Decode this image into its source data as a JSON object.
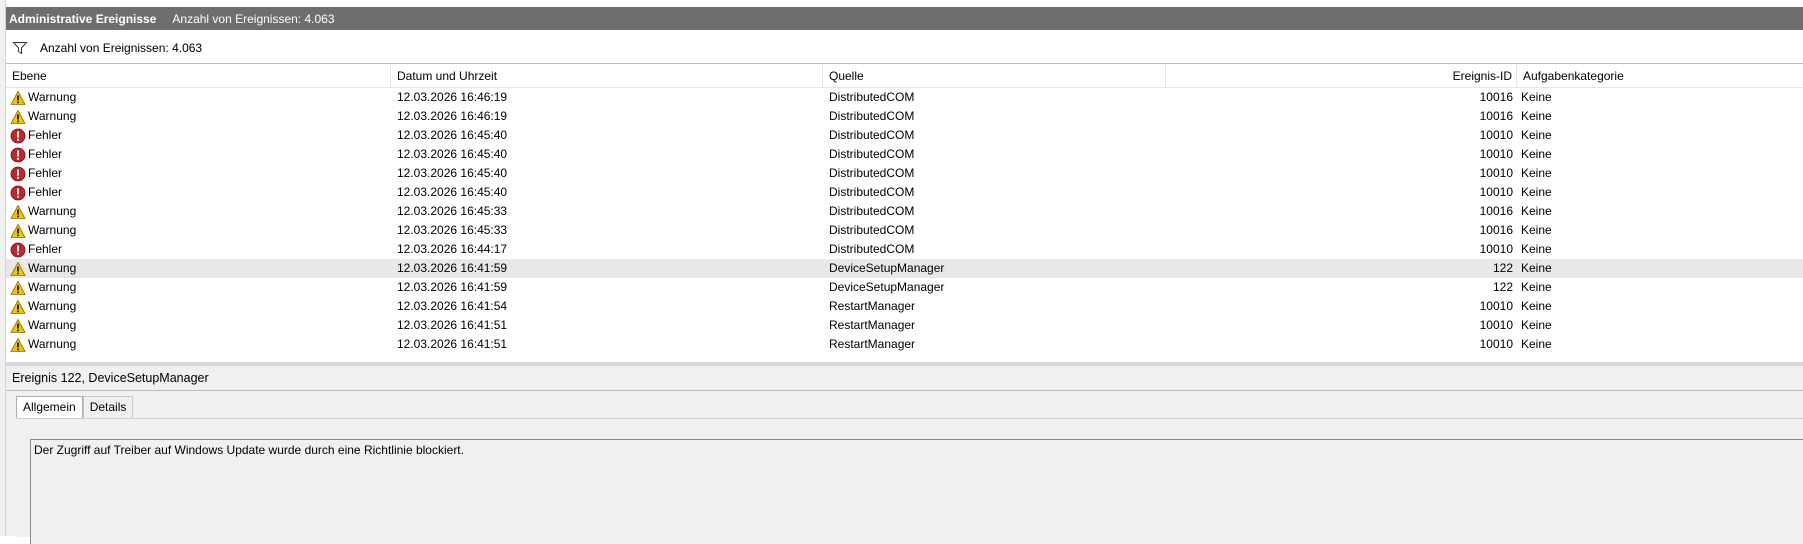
{
  "header": {
    "title": "Administrative Ereignisse",
    "count_label": "Anzahl von Ereignissen: 4.063"
  },
  "filter_bar": {
    "count_label": "Anzahl von Ereignissen: 4.063",
    "icon": "filter-icon"
  },
  "columns": {
    "level": "Ebene",
    "date": "Datum und Uhrzeit",
    "source": "Quelle",
    "event_id": "Ereignis-ID",
    "category": "Aufgabenkategorie"
  },
  "rows": [
    {
      "level": "Warnung",
      "icon": "warning-icon",
      "date": "12.03.2026 16:46:19",
      "source": "DistributedCOM",
      "event_id": "10016",
      "category": "Keine"
    },
    {
      "level": "Warnung",
      "icon": "warning-icon",
      "date": "12.03.2026 16:46:19",
      "source": "DistributedCOM",
      "event_id": "10016",
      "category": "Keine"
    },
    {
      "level": "Fehler",
      "icon": "error-icon",
      "date": "12.03.2026 16:45:40",
      "source": "DistributedCOM",
      "event_id": "10010",
      "category": "Keine"
    },
    {
      "level": "Fehler",
      "icon": "error-icon",
      "date": "12.03.2026 16:45:40",
      "source": "DistributedCOM",
      "event_id": "10010",
      "category": "Keine"
    },
    {
      "level": "Fehler",
      "icon": "error-icon",
      "date": "12.03.2026 16:45:40",
      "source": "DistributedCOM",
      "event_id": "10010",
      "category": "Keine"
    },
    {
      "level": "Fehler",
      "icon": "error-icon",
      "date": "12.03.2026 16:45:40",
      "source": "DistributedCOM",
      "event_id": "10010",
      "category": "Keine"
    },
    {
      "level": "Warnung",
      "icon": "warning-icon",
      "date": "12.03.2026 16:45:33",
      "source": "DistributedCOM",
      "event_id": "10016",
      "category": "Keine"
    },
    {
      "level": "Warnung",
      "icon": "warning-icon",
      "date": "12.03.2026 16:45:33",
      "source": "DistributedCOM",
      "event_id": "10016",
      "category": "Keine"
    },
    {
      "level": "Fehler",
      "icon": "error-icon",
      "date": "12.03.2026 16:44:17",
      "source": "DistributedCOM",
      "event_id": "10010",
      "category": "Keine"
    },
    {
      "level": "Warnung",
      "icon": "warning-icon",
      "date": "12.03.2026 16:41:59",
      "source": "DeviceSetupManager",
      "event_id": "122",
      "category": "Keine",
      "selected": true
    },
    {
      "level": "Warnung",
      "icon": "warning-icon",
      "date": "12.03.2026 16:41:59",
      "source": "DeviceSetupManager",
      "event_id": "122",
      "category": "Keine"
    },
    {
      "level": "Warnung",
      "icon": "warning-icon",
      "date": "12.03.2026 16:41:54",
      "source": "RestartManager",
      "event_id": "10010",
      "category": "Keine"
    },
    {
      "level": "Warnung",
      "icon": "warning-icon",
      "date": "12.03.2026 16:41:51",
      "source": "RestartManager",
      "event_id": "10010",
      "category": "Keine"
    },
    {
      "level": "Warnung",
      "icon": "warning-icon",
      "date": "12.03.2026 16:41:51",
      "source": "RestartManager",
      "event_id": "10010",
      "category": "Keine"
    }
  ],
  "details": {
    "title": "Ereignis 122, DeviceSetupManager",
    "tabs": [
      {
        "label": "Allgemein",
        "active": true
      },
      {
        "label": "Details",
        "active": false
      }
    ],
    "message": "Der Zugriff auf Treiber auf Windows Update wurde durch eine Richtlinie blockiert."
  },
  "colors": {
    "title_bar_bg": "#6e6e6e",
    "selected_row_bg": "#e8e8e8",
    "warning_yellow": "#f2c400",
    "error_red": "#c0272d"
  }
}
